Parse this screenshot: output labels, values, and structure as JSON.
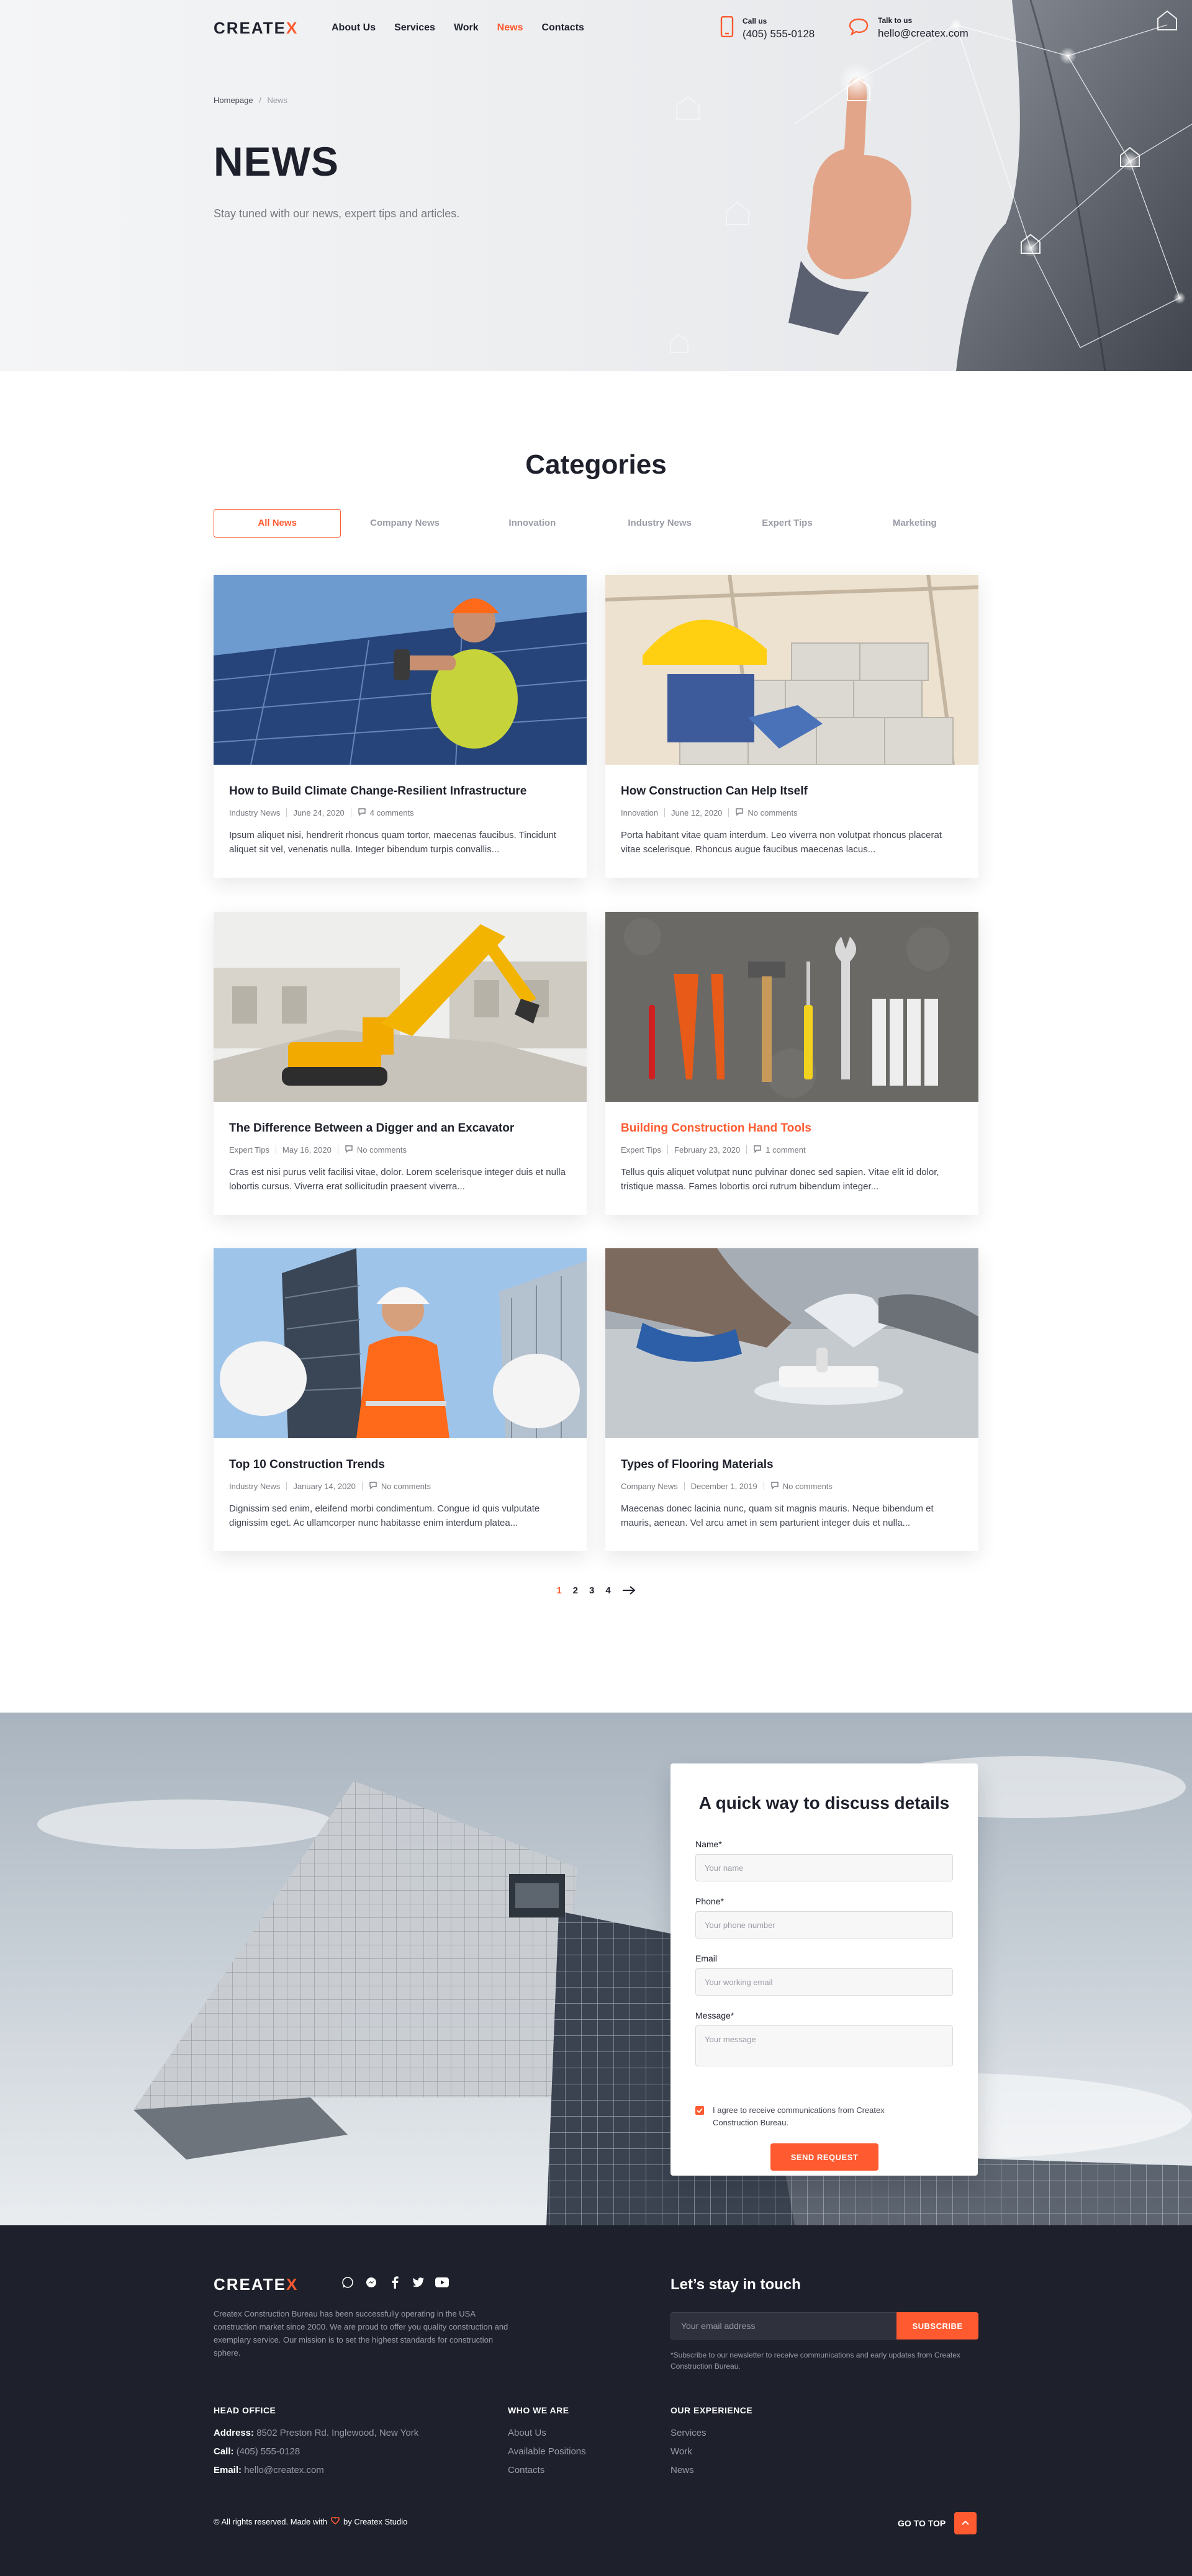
{
  "brand": {
    "logo_main": "CREATE",
    "logo_accent": "X",
    "accent": "#ff5a30",
    "dark": "#1e212c"
  },
  "nav": {
    "items": [
      "About Us",
      "Services",
      "Work",
      "News",
      "Contacts"
    ],
    "active": "News"
  },
  "header_contacts": {
    "call_label": "Call us",
    "call_value": "(405) 555-0128",
    "call_icon": "phone-icon",
    "talk_label": "Talk to us",
    "talk_value": "hello@createx.com",
    "talk_icon": "chat-icon"
  },
  "breadcrumb": {
    "home": "Homepage",
    "separator": "/",
    "current": "News"
  },
  "hero": {
    "title": "NEWS",
    "subtitle": "Stay tuned with our news, expert tips and articles."
  },
  "categories": {
    "title": "Categories",
    "tabs": [
      "All News",
      "Company News",
      "Innovation",
      "Industry News",
      "Expert Tips",
      "Marketing"
    ],
    "active": "All News"
  },
  "posts": [
    {
      "title": "How to Build Climate Change-Resilient Infrastructure",
      "category": "Industry News",
      "date": "June 24, 2020",
      "comments": "4 comments",
      "excerpt": "Ipsum aliquet nisi, hendrerit rhoncus quam tortor, maecenas faucibus. Tincidunt aliquet sit vel, venenatis nulla. Integer bibendum turpis convallis...",
      "highlighted": false
    },
    {
      "title": "How Construction Can Help Itself",
      "category": "Innovation",
      "date": "June 12, 2020",
      "comments": "No comments",
      "excerpt": "Porta habitant vitae quam interdum. Leo viverra non volutpat rhoncus placerat vitae scelerisque. Rhoncus augue faucibus maecenas lacus...",
      "highlighted": false
    },
    {
      "title": "The Difference Between a Digger and an Excavator",
      "category": "Expert Tips",
      "date": "May 16, 2020",
      "comments": "No comments",
      "excerpt": "Cras est nisi purus velit facilisi vitae, dolor. Lorem scelerisque integer duis et nulla lobortis cursus. Viverra erat sollicitudin praesent viverra...",
      "highlighted": false
    },
    {
      "title": "Building Construction Hand Tools",
      "category": "Expert Tips",
      "date": "February 23, 2020",
      "comments": "1 comment",
      "excerpt": "Tellus quis aliquet volutpat nunc pulvinar donec sed sapien. Vitae elit id dolor, tristique massa. Fames lobortis orci rutrum bibendum integer...",
      "highlighted": true
    },
    {
      "title": "Top 10 Construction Trends",
      "category": "Industry News",
      "date": "January 14, 2020",
      "comments": "No comments",
      "excerpt": "Dignissim sed enim, eleifend morbi condimentum. Congue id quis vulputate dignissim eget. Ac ullamcorper nunc habitasse enim interdum platea...",
      "highlighted": false
    },
    {
      "title": "Types of Flooring Materials",
      "category": "Company News",
      "date": "December 1, 2019",
      "comments": "No comments",
      "excerpt": "Maecenas donec lacinia nunc, quam sit magnis mauris. Neque bibendum et mauris, aenean. Vel arcu amet in sem parturient  integer duis et nulla...",
      "highlighted": false
    }
  ],
  "pagination": {
    "pages": [
      "1",
      "2",
      "3",
      "4"
    ],
    "current": "1",
    "next_icon": "arrow-right-icon"
  },
  "cta_form": {
    "title": "A quick way to discuss details",
    "name_label": "Name*",
    "name_placeholder": "Your name",
    "phone_label": "Phone*",
    "phone_placeholder": "Your phone number",
    "email_label": "Email",
    "email_placeholder": "Your working email",
    "message_label": "Message*",
    "message_placeholder": "Your message",
    "consent": "I agree to receive communications from Createx Construction Bureau.",
    "consent_checked": true,
    "submit": "SEND REQUEST"
  },
  "footer": {
    "about": "Createx Construction Bureau has been successfully operating in the USA construction market since 2000. We are proud to offer you quality construction and exemplary service. Our mission is to set the highest standards for construction sphere.",
    "socials": [
      "whatsapp-icon",
      "messenger-icon",
      "facebook-icon",
      "twitter-icon",
      "youtube-icon"
    ],
    "newsletter_title": "Let’s stay in touch",
    "newsletter_placeholder": "Your email address",
    "newsletter_button": "SUBSCRIBE",
    "newsletter_note": "*Subscribe to our newsletter to receive communications and early updates from Createx Construction Bureau.",
    "head_office_title": "HEAD OFFICE",
    "address_label": "Address:",
    "address": "8502 Preston Rd. Inglewood, New York",
    "call_label": "Call:",
    "call": "(405) 555-0128",
    "email_label": "Email:",
    "email": "hello@createx.com",
    "who_title": "WHO WE ARE",
    "who_links": [
      "About Us",
      "Available Positions",
      "Contacts"
    ],
    "exp_title": "OUR EXPERIENCE",
    "exp_links": [
      "Services",
      "Work",
      "News"
    ],
    "copyright_pre": "© All rights reserved. Made with",
    "copyright_post": "by Createx Studio",
    "go_top": "GO TO TOP"
  }
}
